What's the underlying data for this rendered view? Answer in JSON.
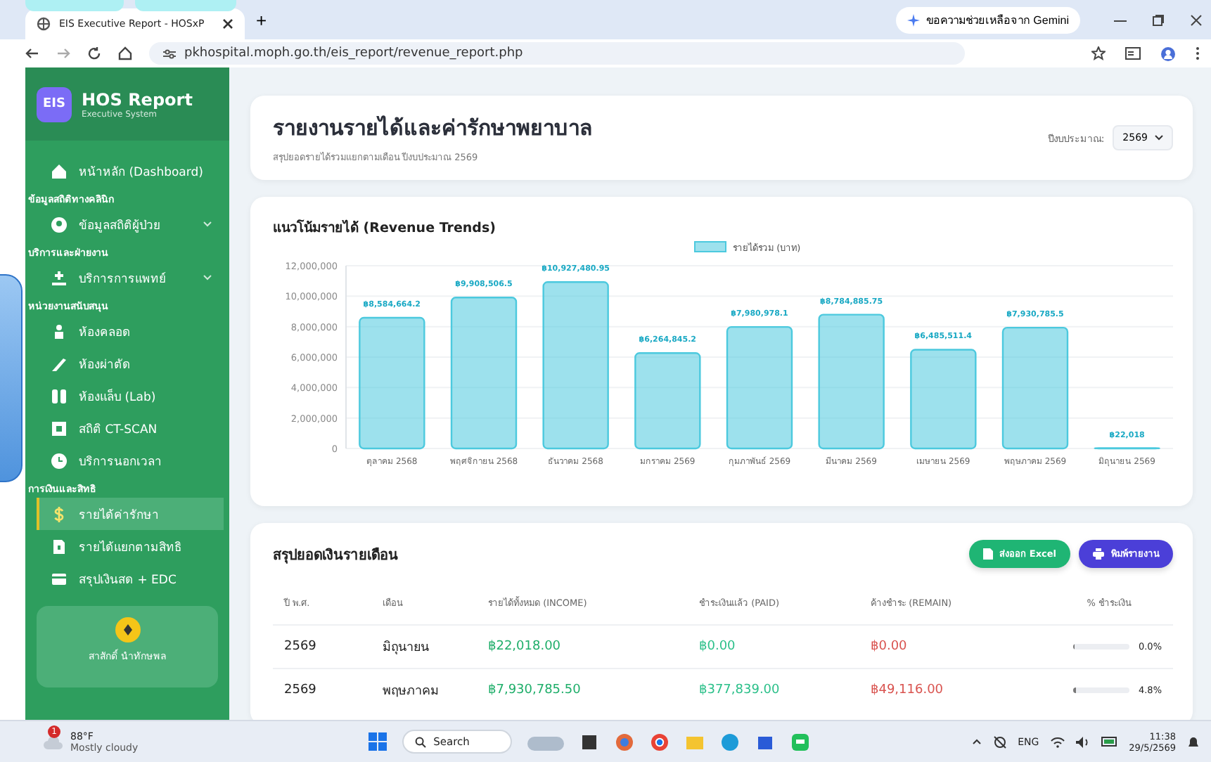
{
  "browser": {
    "tab_title": "EIS Executive Report - HOSxP",
    "new_tab": "+",
    "gemini": "ขอความช่วยเหลือจาก Gemini",
    "url": "pkhospital.moph.go.th/eis_report/revenue_report.php"
  },
  "sidebar": {
    "logo": "EIS",
    "title": "HOS Report",
    "subtitle": "Executive System",
    "nav": [
      {
        "kind": "item",
        "label": "หน้าหลัก (Dashboard)",
        "selected": false,
        "has_submenu": false
      },
      {
        "kind": "heading",
        "label": "ข้อมูลสถิติทางคลินิก"
      },
      {
        "kind": "item",
        "label": "ข้อมูลสถิติผู้ป่วย",
        "selected": false,
        "has_submenu": true
      },
      {
        "kind": "heading",
        "label": "บริการและฝ่ายงาน"
      },
      {
        "kind": "item",
        "label": "บริการการแพทย์",
        "selected": false,
        "has_submenu": true
      },
      {
        "kind": "heading",
        "label": "หน่วยงานสนับสนุน"
      },
      {
        "kind": "item",
        "label": "ห้องคลอด",
        "selected": false,
        "has_submenu": false
      },
      {
        "kind": "item",
        "label": "ห้องผ่าตัด",
        "selected": false,
        "has_submenu": false
      },
      {
        "kind": "item",
        "label": "ห้องแล็บ (Lab)",
        "selected": false,
        "has_submenu": false
      },
      {
        "kind": "item",
        "label": "สถิติ CT-SCAN",
        "selected": false,
        "has_submenu": false
      },
      {
        "kind": "item",
        "label": "บริการนอกเวลา",
        "selected": false,
        "has_submenu": false
      },
      {
        "kind": "heading",
        "label": "การเงินและสิทธิ"
      },
      {
        "kind": "item",
        "label": "รายได้ค่ารักษา",
        "selected": true,
        "has_submenu": false
      },
      {
        "kind": "item",
        "label": "รายได้แยกตามสิทธิ",
        "selected": false,
        "has_submenu": false
      },
      {
        "kind": "item",
        "label": "สรุปเงินสด + EDC",
        "selected": false,
        "has_submenu": false
      }
    ],
    "user": "สาสักดิ์ นำทักษพล"
  },
  "header": {
    "title": "รายงานรายได้และค่ารักษาพยาบาล",
    "subtitle": "สรุปยอดรายได้รวมแยกตามเดือน ปีงบประมาณ 2569",
    "year_label": "ปีงบประมาณ:",
    "year": "2569"
  },
  "revenue_chart": {
    "title": "แนวโน้มรายได้ (Revenue Trends)",
    "chart_data": {
      "type": "bar",
      "categories": [
        "ตุลาคม 2568",
        "พฤศจิกายน 2568",
        "ธันวาคม 2568",
        "มกราคม 2569",
        "กุมภาพันธ์ 2569",
        "มีนาคม 2569",
        "เมษายน 2569",
        "พฤษภาคม 2569",
        "มิถุนายน 2569"
      ],
      "series": [
        {
          "name": "รายได้รวม (บาท)",
          "color": "#4cc9de",
          "values": [
            8584664.2,
            9908506.5,
            10927480.95,
            6264845.2,
            7980978.1,
            8784885.75,
            6485511.4,
            7930785.5,
            22018
          ]
        }
      ],
      "grid": true,
      "ylim": [
        0,
        12000000
      ],
      "yticks": [
        {
          "value": 0,
          "label": "0"
        },
        {
          "value": 2000000,
          "label": "2,000,000"
        },
        {
          "value": 4000000,
          "label": "4,000,000"
        },
        {
          "value": 6000000,
          "label": "6,000,000"
        },
        {
          "value": 8000000,
          "label": "8,000,000"
        },
        {
          "value": 10000000,
          "label": "10,000,000"
        },
        {
          "value": 12000000,
          "label": "12,000,000"
        }
      ],
      "value_labels": [
        "฿8,584,664.2",
        "฿9,908,506.5",
        "฿10,927,480.95",
        "฿6,264,845.2",
        "฿7,980,978.1",
        "฿8,784,885.75",
        "฿6,485,511.4",
        "฿7,930,785.5",
        "฿22,018"
      ]
    }
  },
  "summary": {
    "title": "สรุปยอดเงินรายเดือน",
    "buttons": [
      {
        "kind": "excel",
        "label": "ส่งออก Excel"
      },
      {
        "kind": "print",
        "label": "พิมพ์รายงาน"
      }
    ],
    "columns": [
      "ปี พ.ศ.",
      "เดือน",
      "รายได้ทั้งหมด (INCOME)",
      "ชำระเงินแล้ว (PAID)",
      "ค้างชำระ (REMAIN)",
      "% ชำระเงิน"
    ],
    "rows": [
      {
        "year": "2569",
        "month": "มิถุนายน",
        "income": "฿22,018.00",
        "paid": "฿0.00",
        "remain": "฿0.00",
        "level": 0.0,
        "percent": "0.0%"
      },
      {
        "year": "2569",
        "month": "พฤษภาคม",
        "income": "฿7,930,785.50",
        "paid": "฿377,839.00",
        "remain": "฿49,116.00",
        "level": 0.048,
        "percent": "4.8%"
      }
    ]
  },
  "taskbar": {
    "weather_badge": "1",
    "temperature": "88°F",
    "weather": "Mostly cloudy",
    "search": "Search",
    "language": "ENG",
    "time": "11:38",
    "date": "29/5/2569"
  }
}
